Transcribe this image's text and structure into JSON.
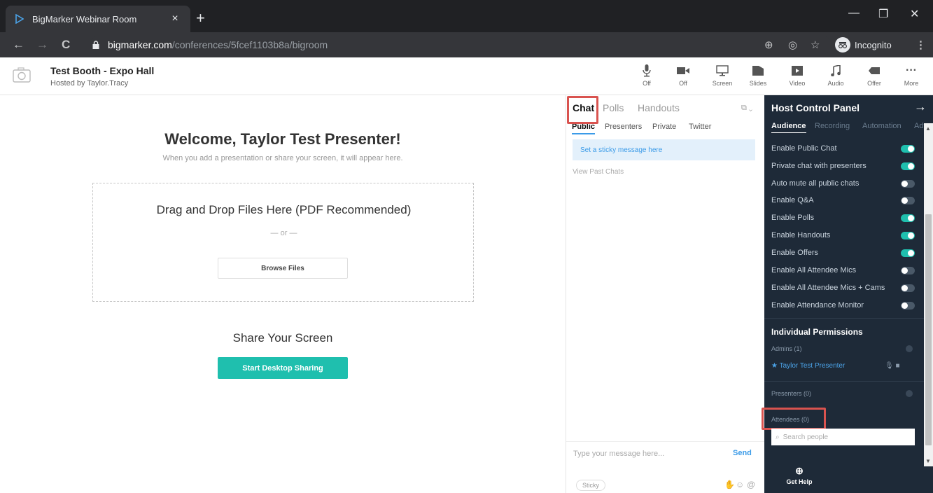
{
  "browser": {
    "tab_title": "BigMarker Webinar Room",
    "tab_close": "×",
    "new_tab": "+",
    "url_host": "bigmarker.com",
    "url_path": "/conferences/5fcef1103b8a/bigroom",
    "incognito_label": "Incognito"
  },
  "header": {
    "title": "Test Booth - Expo Hall",
    "host": "Hosted by Taylor.Tracy",
    "tools": [
      {
        "label": "Off",
        "icon": "mic-icon"
      },
      {
        "label": "Off",
        "icon": "camera-icon"
      },
      {
        "label": "Screen",
        "icon": "screen-icon"
      },
      {
        "label": "Slides",
        "icon": "slides-icon"
      },
      {
        "label": "Video",
        "icon": "video-icon"
      },
      {
        "label": "Audio",
        "icon": "music-icon"
      },
      {
        "label": "Offer",
        "icon": "offer-icon"
      },
      {
        "label": "More",
        "icon": "more-icon"
      }
    ]
  },
  "stage": {
    "welcome": "Welcome, Taylor Test Presenter!",
    "welcome_sub": "When you add a presentation or share your screen, it will appear here.",
    "drop_title": "Drag and Drop Files Here (PDF Recommended)",
    "drop_or": "— or —",
    "browse_label": "Browse Files",
    "share_title": "Share Your Screen",
    "share_button": "Start Desktop Sharing"
  },
  "chat": {
    "tabs": [
      "Chat",
      "Polls",
      "Handouts"
    ],
    "subtabs": [
      "Public",
      "Presenters",
      "Private",
      "Twitter"
    ],
    "sticky_placeholder": "Set a sticky message here",
    "past_chats": "View Past Chats",
    "input_placeholder": "Type your message here...",
    "send": "Send",
    "sticky_pill": "Sticky"
  },
  "hcp": {
    "title": "Host Control Panel",
    "arrow": "→",
    "tabs": [
      "Audience",
      "Recording",
      "Automation",
      "Adva"
    ],
    "settings": [
      {
        "label": "Enable Public Chat",
        "on": true
      },
      {
        "label": "Private chat with presenters",
        "on": true
      },
      {
        "label": "Auto mute all public chats",
        "on": false
      },
      {
        "label": "Enable Q&A",
        "on": false
      },
      {
        "label": "Enable Polls",
        "on": true
      },
      {
        "label": "Enable Handouts",
        "on": true
      },
      {
        "label": "Enable Offers",
        "on": true
      },
      {
        "label": "Enable All Attendee Mics",
        "on": false
      },
      {
        "label": "Enable All Attendee Mics + Cams",
        "on": false
      },
      {
        "label": "Enable Attendance Monitor",
        "on": false
      }
    ],
    "permissions_title": "Individual Permissions",
    "admins_label": "Admins (1)",
    "admin_person": "★ Taylor Test Presenter",
    "presenters_label": "Presenters (0)",
    "attendees_label": "Attendees (0)",
    "search_placeholder": "Search people",
    "help_label": "Get Help"
  },
  "colors": {
    "accent": "#1fbfae",
    "highlight": "#d9534f",
    "panel": "#1e2a38",
    "link": "#3b9be8"
  }
}
